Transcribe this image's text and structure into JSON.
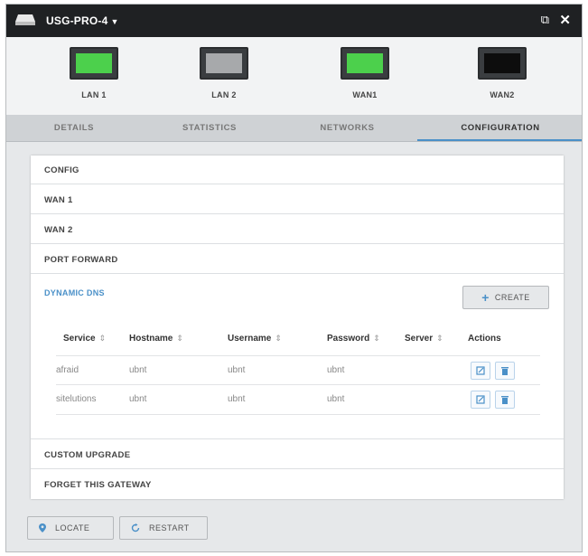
{
  "title": "USG-PRO-4",
  "ports": [
    {
      "label": "LAN 1",
      "color": "#4cd04c"
    },
    {
      "label": "LAN 2",
      "color": "#a7a9ab"
    },
    {
      "label": "WAN1",
      "color": "#4cd04c"
    },
    {
      "label": "WAN2",
      "color": "#0d0d0d"
    }
  ],
  "tabs": [
    "DETAILS",
    "STATISTICS",
    "NETWORKS",
    "CONFIGURATION"
  ],
  "active_tab": "CONFIGURATION",
  "sections": {
    "config": "CONFIG",
    "wan1": "WAN 1",
    "wan2": "WAN 2",
    "port_forward": "PORT FORWARD",
    "dynamic_dns": "DYNAMIC DNS",
    "custom_upgrade": "CUSTOM UPGRADE",
    "forget_gateway": "FORGET THIS GATEWAY"
  },
  "create_label": "CREATE",
  "table": {
    "headers": {
      "service": "Service",
      "hostname": "Hostname",
      "username": "Username",
      "password": "Password",
      "server": "Server",
      "actions": "Actions"
    },
    "rows": [
      {
        "service": "afraid",
        "hostname": "ubnt",
        "username": "ubnt",
        "password": "ubnt"
      },
      {
        "service": "sitelutions",
        "hostname": "ubnt",
        "username": "ubnt",
        "password": "ubnt"
      }
    ]
  },
  "buttons": {
    "locate": "LOCATE",
    "restart": "RESTART"
  },
  "accent": "#4a90c8"
}
